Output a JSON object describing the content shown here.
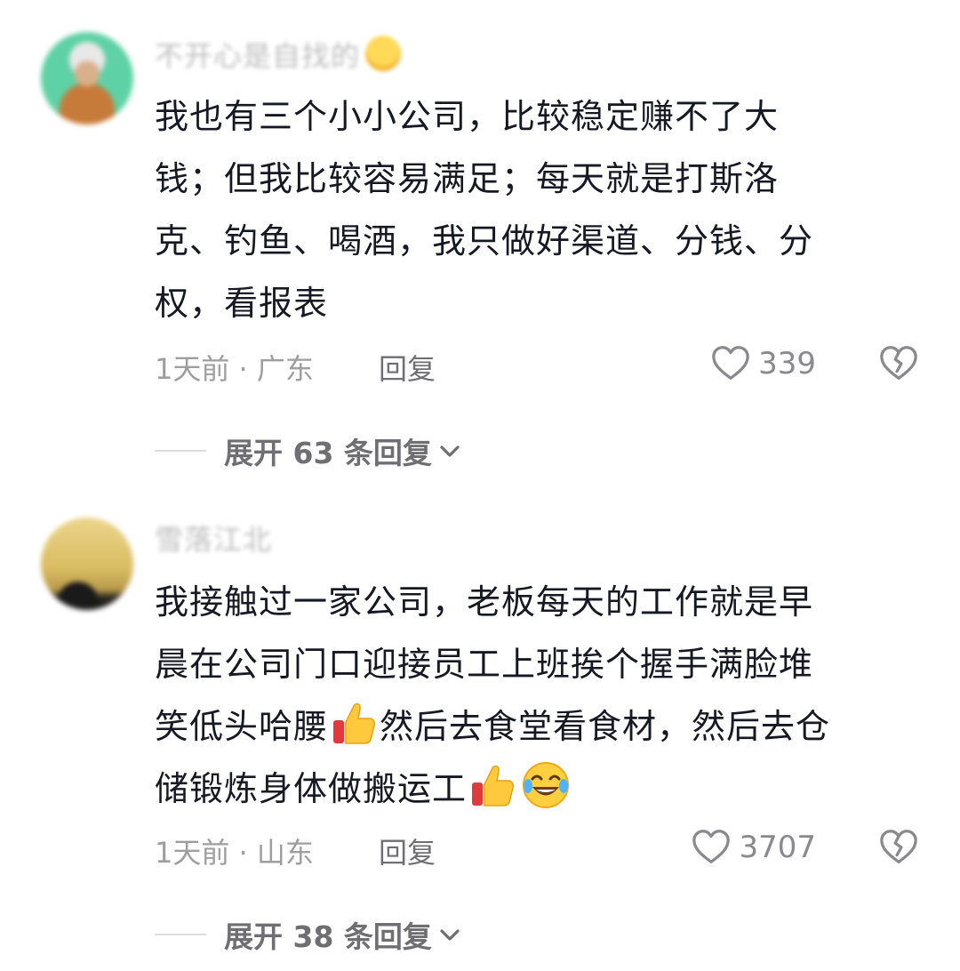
{
  "comments": [
    {
      "username": "不开心是自找的",
      "text_lines": [
        "我也有三个小小公司，比较稳定赚不了大",
        "钱；但我比较容易满足；每天就是打斯洛",
        "克、钓鱼、喝酒，我只做好渠道、分钱、分",
        "权，看报表"
      ],
      "time_location": "1天前 · 广东",
      "reply_label": "回复",
      "like_count": "339",
      "expand_label": "展开 63 条回复"
    },
    {
      "username": "雪落江北",
      "text_lines": [
        "我接触过一家公司，老板每天的工作就是早",
        "晨在公司门口迎接员工上班挨个握手满脸堆",
        "笑低头哈腰",
        "然后去食堂看食材，然后去仓",
        "储锻炼身体做搬运工"
      ],
      "time_location": "1天前 · 山东",
      "reply_label": "回复",
      "like_count": "3707",
      "expand_label": "展开 38 条回复"
    }
  ],
  "icons": {
    "like": "heart-outline-icon",
    "dislike": "broken-heart-icon",
    "expand": "chevron-down-icon",
    "emoji_thumb": "thumbs-up-emoji",
    "emoji_laugh": "rofl-emoji"
  }
}
